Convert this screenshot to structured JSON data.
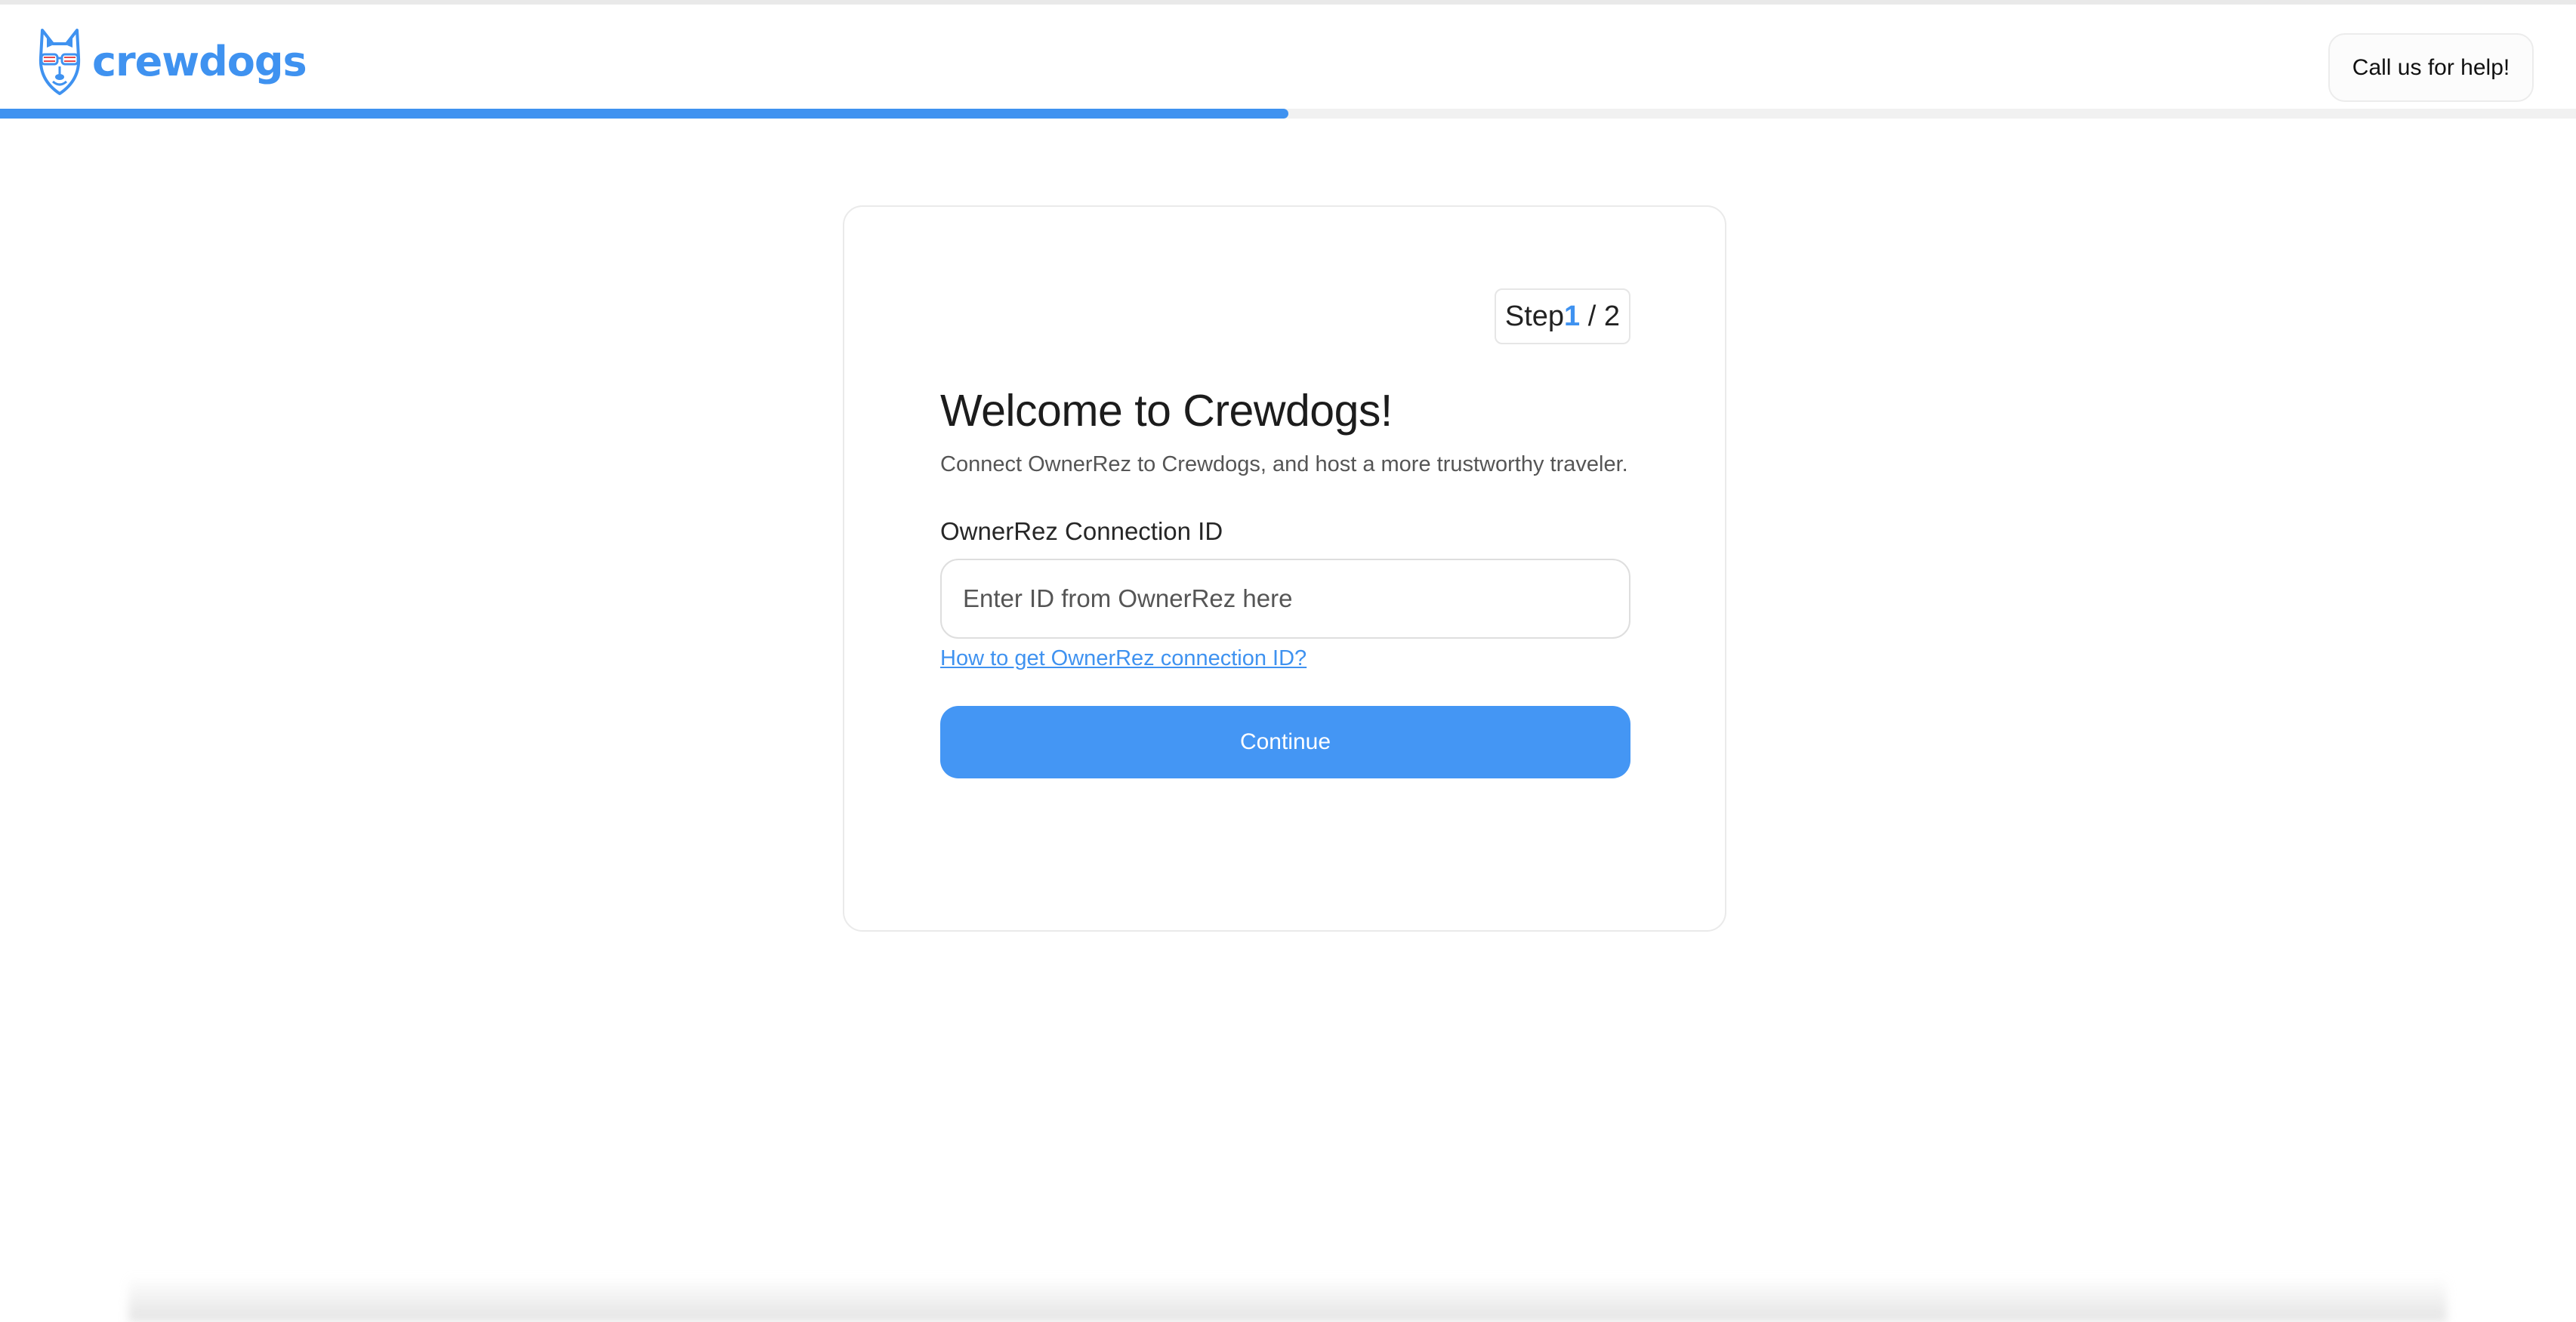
{
  "brand": {
    "name": "crewdogs",
    "color": "#3f92f0"
  },
  "header": {
    "help_button_label": "Call us for help!"
  },
  "progress": {
    "fraction": 0.5
  },
  "card": {
    "step": {
      "label": "Step",
      "current": "1",
      "separator": " / ",
      "total": "2"
    },
    "title": "Welcome to Crewdogs!",
    "subtitle": "Connect OwnerRez to Crewdogs, and host a more trustworthy traveler.",
    "connection_field": {
      "label": "OwnerRez Connection ID",
      "value": "",
      "placeholder": "Enter ID from OwnerRez here"
    },
    "help_link": "How to get OwnerRez connection ID?",
    "continue_label": "Continue"
  },
  "icons": {
    "logo": "husky-dog-with-sunglasses-icon"
  }
}
